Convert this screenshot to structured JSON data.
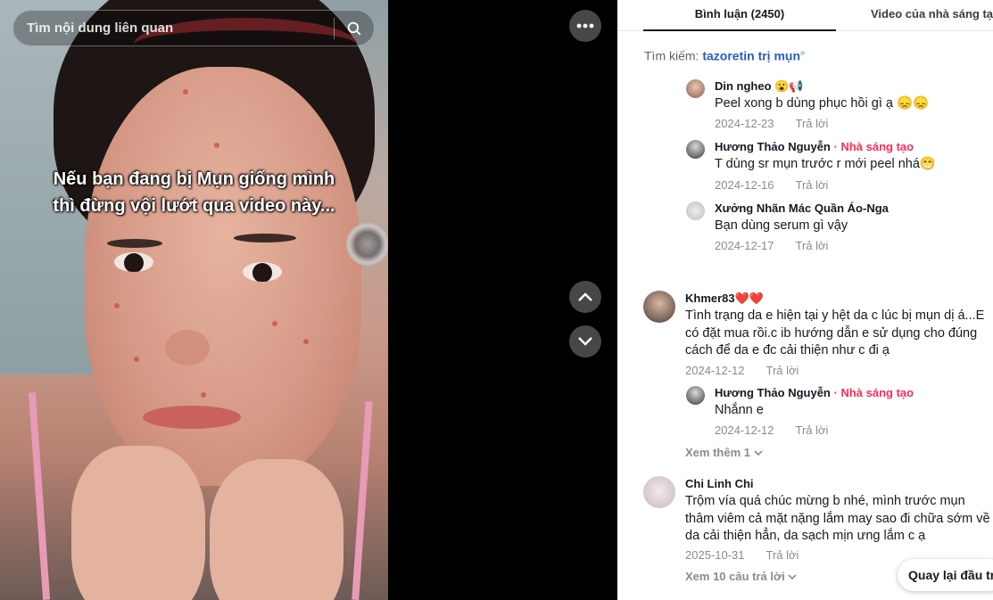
{
  "search": {
    "placeholder": "Tìm nội dung liên quan"
  },
  "video": {
    "caption_line1": "Nếu bạn đang bị Mụn giống mình",
    "caption_line2": "thì đừng vội lướt qua video này..."
  },
  "tabs": {
    "comments": "Bình luận (2450)",
    "creator_videos": "Video của nhà sáng tạo"
  },
  "related_search": {
    "label": "Tìm kiếm:",
    "keyword": "tazoretin trị mụn"
  },
  "comments": [
    {
      "name": "Din ngheo",
      "name_suffix": "😮📢",
      "text": "Peel xong b dùng phục hồi gì ạ 😞😞",
      "date": "2024-12-23",
      "reply": "Trả lời"
    },
    {
      "name": "Hương Thảo Nguyễn",
      "tag": "· Nhà sáng tạo",
      "text": "T dùng sr mụn trước r mới peel nhá😁",
      "date": "2024-12-16",
      "reply": "Trả lời"
    },
    {
      "name": "Xưởng Nhãn Mác Quần Áo-Nga",
      "text": "Bạn dùng serum gì vậy",
      "date": "2024-12-17",
      "reply": "Trả lời"
    },
    {
      "name": "Khmer83",
      "name_suffix": "❤️❤️",
      "text": "Tình trạng da e hiện tại y hệt da c lúc bị mụn dị á...E có đặt mua rồi.c ib hướng dẫn e sử dụng cho đúng cách để da e đc cải thiện như c đi ạ",
      "date": "2024-12-12",
      "reply": "Trả lời"
    },
    {
      "name": "Hương Thảo Nguyễn",
      "tag": "· Nhà sáng tạo",
      "text": "Nhắnn e",
      "date": "2024-12-12",
      "reply": "Trả lời"
    },
    {
      "name": "Chi Linh Chi",
      "text": "Trộm vía quá chúc mừng b nhé, mình trước mụn thâm viêm cả mặt nặng lắm may sao đi chữa sớm về da cải thiện hẳn, da sạch mịn ưng lắm c ạ",
      "date": "2025-10-31",
      "reply": "Trả lời"
    }
  ],
  "view_more_1": "Xem thêm 1",
  "view_replies": "Xem 10 câu trả lời",
  "back_to_top": "Quay lại đầu trang",
  "icons": {
    "search": "search-icon",
    "more": "more-dots-icon",
    "up": "chevron-up-icon",
    "down": "chevron-down-icon"
  }
}
